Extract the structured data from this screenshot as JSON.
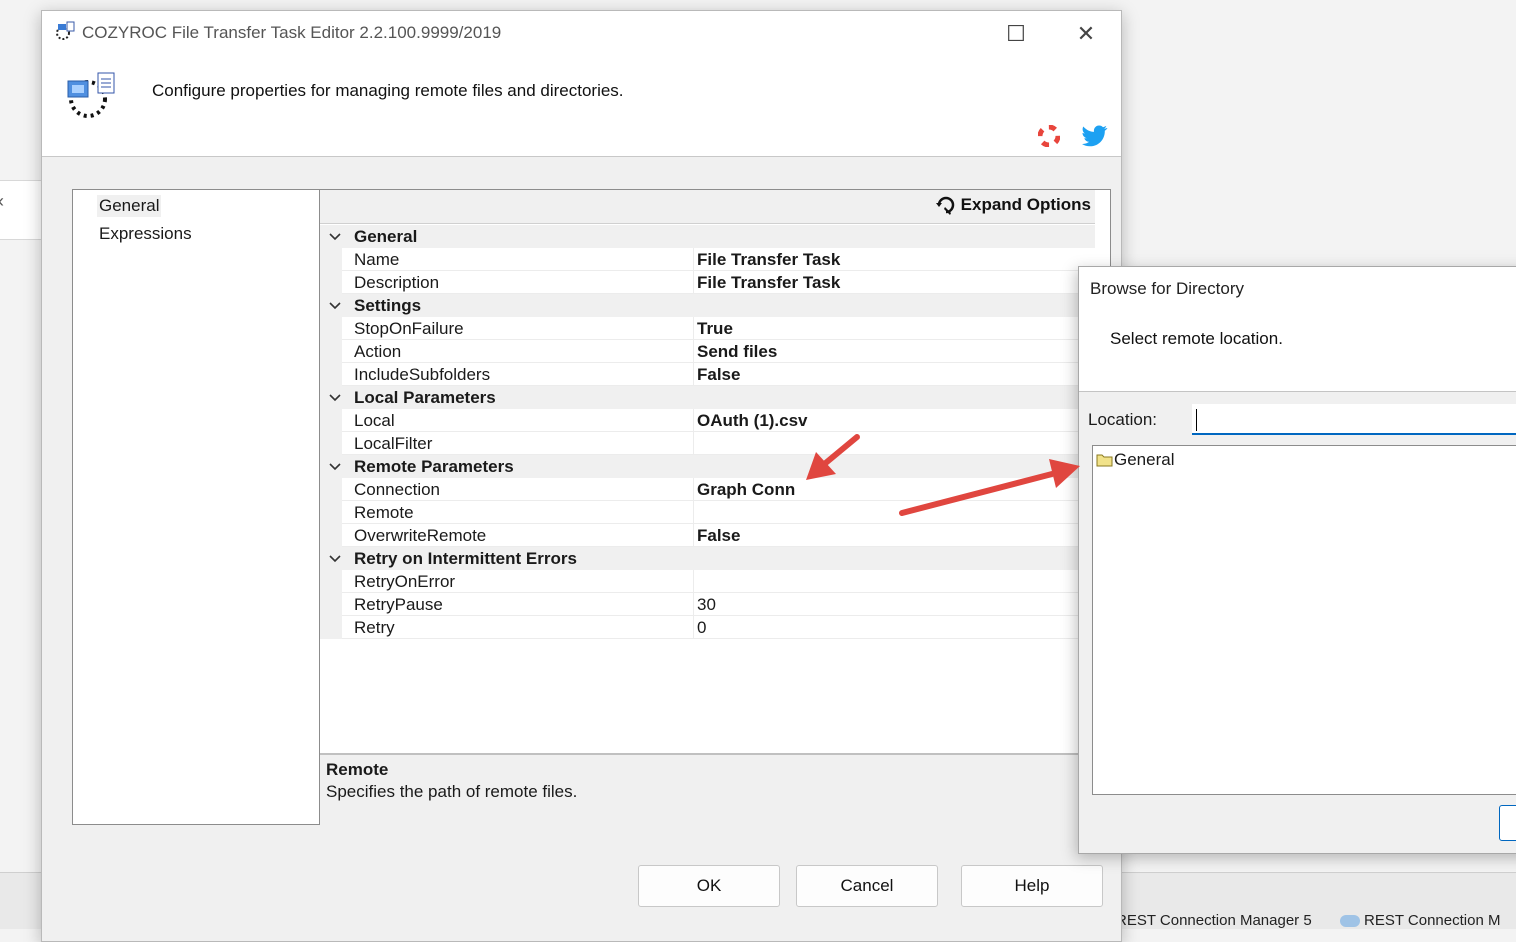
{
  "background": {
    "bottom_tabs": [
      "REST Connection Manager 5",
      "REST Connection M"
    ]
  },
  "editor": {
    "title": "COZYROC File Transfer Task Editor 2.2.100.9999/2019",
    "description": "Configure properties for managing remote files and directories.",
    "nav": {
      "items": [
        "General",
        "Expressions"
      ],
      "selected": "General"
    },
    "toolbar": {
      "expand_options": "Expand Options"
    },
    "grid": {
      "categories": [
        {
          "name": "General",
          "props": [
            {
              "name": "Name",
              "value": "File Transfer Task",
              "bold": true
            },
            {
              "name": "Description",
              "value": "File Transfer Task",
              "bold": true
            }
          ]
        },
        {
          "name": "Settings",
          "props": [
            {
              "name": "StopOnFailure",
              "value": "True",
              "bold": true
            },
            {
              "name": "Action",
              "value": "Send files",
              "bold": true
            },
            {
              "name": "IncludeSubfolders",
              "value": "False",
              "bold": true
            }
          ]
        },
        {
          "name": "Local Parameters",
          "props": [
            {
              "name": "Local",
              "value": "OAuth (1).csv",
              "bold": true
            },
            {
              "name": "LocalFilter",
              "value": "",
              "bold": false
            }
          ]
        },
        {
          "name": "Remote Parameters",
          "props": [
            {
              "name": "Connection",
              "value": "Graph Conn",
              "bold": true
            },
            {
              "name": "Remote",
              "value": "",
              "bold": false
            },
            {
              "name": "OverwriteRemote",
              "value": "False",
              "bold": true
            }
          ]
        },
        {
          "name": "Retry on Intermittent Errors",
          "props": [
            {
              "name": "RetryOnError",
              "value": "",
              "bold": false
            },
            {
              "name": "RetryPause",
              "value": "30",
              "bold": false
            },
            {
              "name": "Retry",
              "value": "0",
              "bold": false
            }
          ]
        }
      ]
    },
    "help": {
      "title": "Remote",
      "text": "Specifies the path of remote files."
    },
    "buttons": {
      "ok": "OK",
      "cancel": "Cancel",
      "help": "Help"
    },
    "window_controls": {
      "maximize": "☐",
      "close": "✕"
    }
  },
  "browse_dialog": {
    "title": "Browse for Directory",
    "prompt": "Select remote location.",
    "location_label": "Location:",
    "location_value": "",
    "tree": [
      "General"
    ]
  },
  "colors": {
    "accent": "#0067c0",
    "arrow": "#e0463f",
    "twitter": "#1da1f2"
  }
}
